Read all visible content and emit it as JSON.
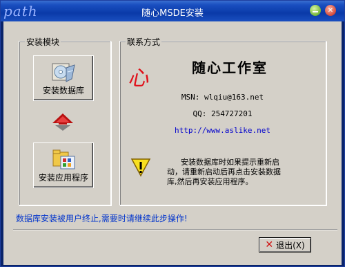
{
  "window": {
    "brand": "path",
    "title": "随心MSDE安装"
  },
  "install_group": {
    "title": "安装模块",
    "install_db_label": "安装数据库",
    "install_app_label": "安装应用程序"
  },
  "contact_group": {
    "title": "联系方式",
    "logo_char": "心",
    "studio_name": "随心工作室",
    "msn": "MSN: wlqiu@163.net",
    "qq": "QQ: 254727201",
    "url": "http://www.aslike.net",
    "note": "安装数据库时如果提示重新启动，请重新启动后再点击安装数据库,然后再安装应用程序。"
  },
  "status_text": "数据库安装被用户终止,需要时请继续此步操作!",
  "exit_button": {
    "label": "退出(X)"
  },
  "colors": {
    "title_bar": "#1a4fc0",
    "face": "#d4d0c8",
    "status": "#0033cc",
    "link": "#0000cc",
    "logo": "#e0101a"
  }
}
